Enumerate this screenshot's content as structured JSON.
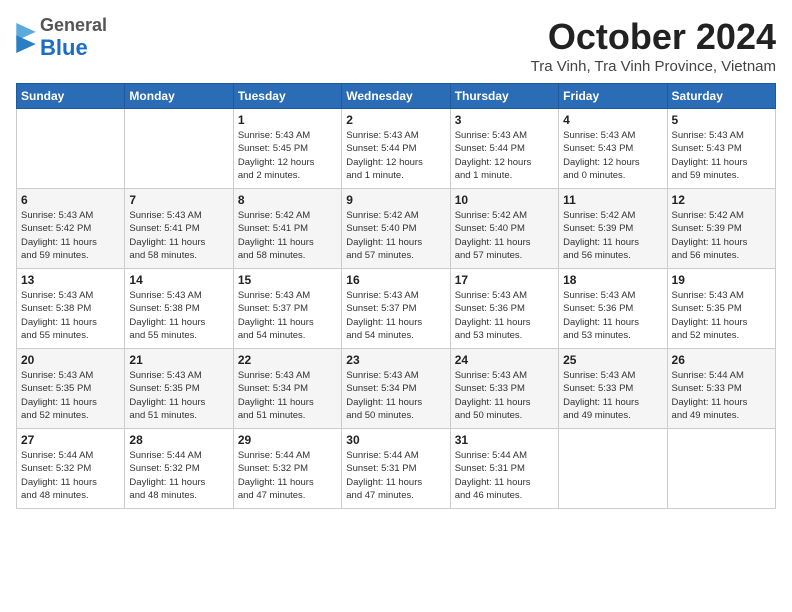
{
  "header": {
    "logo_general": "General",
    "logo_blue": "Blue",
    "month_title": "October 2024",
    "location": "Tra Vinh, Tra Vinh Province, Vietnam"
  },
  "weekdays": [
    "Sunday",
    "Monday",
    "Tuesday",
    "Wednesday",
    "Thursday",
    "Friday",
    "Saturday"
  ],
  "weeks": [
    [
      {
        "day": "",
        "info": ""
      },
      {
        "day": "",
        "info": ""
      },
      {
        "day": "1",
        "info": "Sunrise: 5:43 AM\nSunset: 5:45 PM\nDaylight: 12 hours\nand 2 minutes."
      },
      {
        "day": "2",
        "info": "Sunrise: 5:43 AM\nSunset: 5:44 PM\nDaylight: 12 hours\nand 1 minute."
      },
      {
        "day": "3",
        "info": "Sunrise: 5:43 AM\nSunset: 5:44 PM\nDaylight: 12 hours\nand 1 minute."
      },
      {
        "day": "4",
        "info": "Sunrise: 5:43 AM\nSunset: 5:43 PM\nDaylight: 12 hours\nand 0 minutes."
      },
      {
        "day": "5",
        "info": "Sunrise: 5:43 AM\nSunset: 5:43 PM\nDaylight: 11 hours\nand 59 minutes."
      }
    ],
    [
      {
        "day": "6",
        "info": "Sunrise: 5:43 AM\nSunset: 5:42 PM\nDaylight: 11 hours\nand 59 minutes."
      },
      {
        "day": "7",
        "info": "Sunrise: 5:43 AM\nSunset: 5:41 PM\nDaylight: 11 hours\nand 58 minutes."
      },
      {
        "day": "8",
        "info": "Sunrise: 5:42 AM\nSunset: 5:41 PM\nDaylight: 11 hours\nand 58 minutes."
      },
      {
        "day": "9",
        "info": "Sunrise: 5:42 AM\nSunset: 5:40 PM\nDaylight: 11 hours\nand 57 minutes."
      },
      {
        "day": "10",
        "info": "Sunrise: 5:42 AM\nSunset: 5:40 PM\nDaylight: 11 hours\nand 57 minutes."
      },
      {
        "day": "11",
        "info": "Sunrise: 5:42 AM\nSunset: 5:39 PM\nDaylight: 11 hours\nand 56 minutes."
      },
      {
        "day": "12",
        "info": "Sunrise: 5:42 AM\nSunset: 5:39 PM\nDaylight: 11 hours\nand 56 minutes."
      }
    ],
    [
      {
        "day": "13",
        "info": "Sunrise: 5:43 AM\nSunset: 5:38 PM\nDaylight: 11 hours\nand 55 minutes."
      },
      {
        "day": "14",
        "info": "Sunrise: 5:43 AM\nSunset: 5:38 PM\nDaylight: 11 hours\nand 55 minutes."
      },
      {
        "day": "15",
        "info": "Sunrise: 5:43 AM\nSunset: 5:37 PM\nDaylight: 11 hours\nand 54 minutes."
      },
      {
        "day": "16",
        "info": "Sunrise: 5:43 AM\nSunset: 5:37 PM\nDaylight: 11 hours\nand 54 minutes."
      },
      {
        "day": "17",
        "info": "Sunrise: 5:43 AM\nSunset: 5:36 PM\nDaylight: 11 hours\nand 53 minutes."
      },
      {
        "day": "18",
        "info": "Sunrise: 5:43 AM\nSunset: 5:36 PM\nDaylight: 11 hours\nand 53 minutes."
      },
      {
        "day": "19",
        "info": "Sunrise: 5:43 AM\nSunset: 5:35 PM\nDaylight: 11 hours\nand 52 minutes."
      }
    ],
    [
      {
        "day": "20",
        "info": "Sunrise: 5:43 AM\nSunset: 5:35 PM\nDaylight: 11 hours\nand 52 minutes."
      },
      {
        "day": "21",
        "info": "Sunrise: 5:43 AM\nSunset: 5:35 PM\nDaylight: 11 hours\nand 51 minutes."
      },
      {
        "day": "22",
        "info": "Sunrise: 5:43 AM\nSunset: 5:34 PM\nDaylight: 11 hours\nand 51 minutes."
      },
      {
        "day": "23",
        "info": "Sunrise: 5:43 AM\nSunset: 5:34 PM\nDaylight: 11 hours\nand 50 minutes."
      },
      {
        "day": "24",
        "info": "Sunrise: 5:43 AM\nSunset: 5:33 PM\nDaylight: 11 hours\nand 50 minutes."
      },
      {
        "day": "25",
        "info": "Sunrise: 5:43 AM\nSunset: 5:33 PM\nDaylight: 11 hours\nand 49 minutes."
      },
      {
        "day": "26",
        "info": "Sunrise: 5:44 AM\nSunset: 5:33 PM\nDaylight: 11 hours\nand 49 minutes."
      }
    ],
    [
      {
        "day": "27",
        "info": "Sunrise: 5:44 AM\nSunset: 5:32 PM\nDaylight: 11 hours\nand 48 minutes."
      },
      {
        "day": "28",
        "info": "Sunrise: 5:44 AM\nSunset: 5:32 PM\nDaylight: 11 hours\nand 48 minutes."
      },
      {
        "day": "29",
        "info": "Sunrise: 5:44 AM\nSunset: 5:32 PM\nDaylight: 11 hours\nand 47 minutes."
      },
      {
        "day": "30",
        "info": "Sunrise: 5:44 AM\nSunset: 5:31 PM\nDaylight: 11 hours\nand 47 minutes."
      },
      {
        "day": "31",
        "info": "Sunrise: 5:44 AM\nSunset: 5:31 PM\nDaylight: 11 hours\nand 46 minutes."
      },
      {
        "day": "",
        "info": ""
      },
      {
        "day": "",
        "info": ""
      }
    ]
  ]
}
